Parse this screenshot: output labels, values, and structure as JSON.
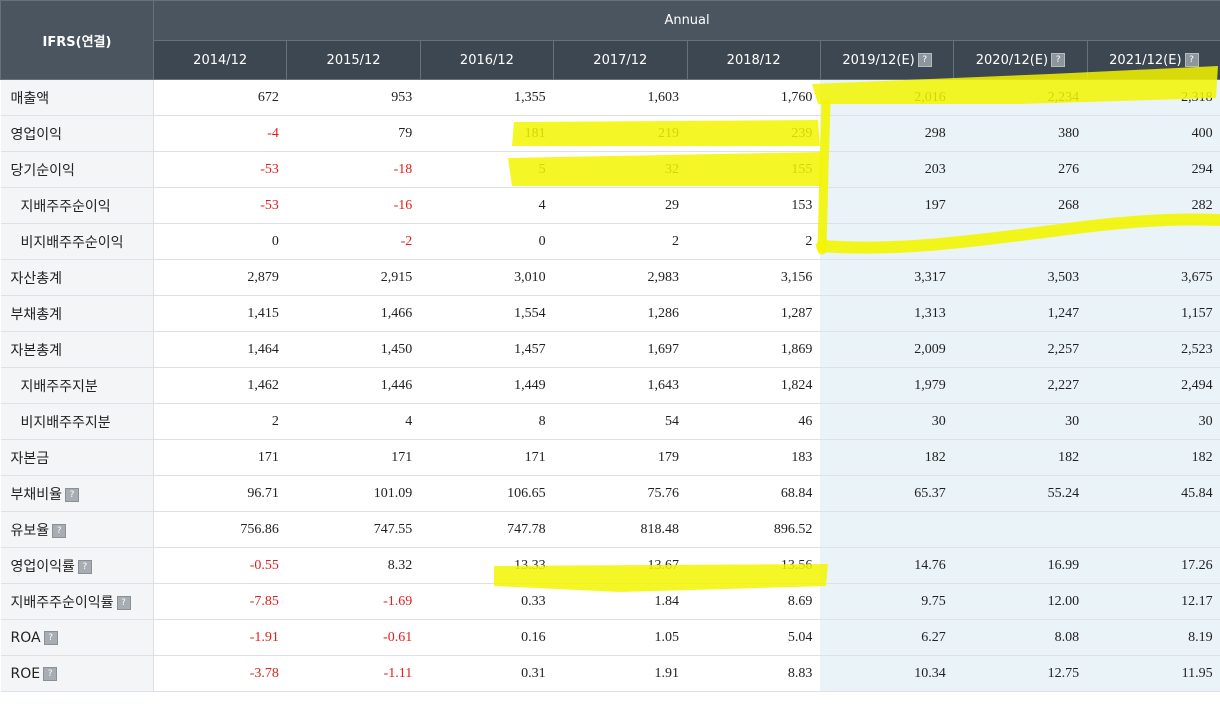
{
  "header": {
    "corner_label": "IFRS(연결)",
    "group_label": "Annual",
    "columns": [
      {
        "label": "2014/12",
        "estimate": false
      },
      {
        "label": "2015/12",
        "estimate": false
      },
      {
        "label": "2016/12",
        "estimate": false
      },
      {
        "label": "2017/12",
        "estimate": false
      },
      {
        "label": "2018/12",
        "estimate": false
      },
      {
        "label": "2019/12(E)",
        "estimate": true
      },
      {
        "label": "2020/12(E)",
        "estimate": true
      },
      {
        "label": "2021/12(E)",
        "estimate": true
      }
    ]
  },
  "rows": [
    {
      "label": "매출액",
      "sub": false,
      "help": false,
      "values": [
        "672",
        "953",
        "1,355",
        "1,603",
        "1,760",
        "2,016",
        "2,234",
        "2,318"
      ]
    },
    {
      "label": "영업이익",
      "sub": false,
      "help": false,
      "values": [
        "-4",
        "79",
        "181",
        "219",
        "239",
        "298",
        "380",
        "400"
      ]
    },
    {
      "label": "당기순이익",
      "sub": false,
      "help": false,
      "values": [
        "-53",
        "-18",
        "5",
        "32",
        "155",
        "203",
        "276",
        "294"
      ]
    },
    {
      "label": "지배주주순이익",
      "sub": true,
      "help": false,
      "values": [
        "-53",
        "-16",
        "4",
        "29",
        "153",
        "197",
        "268",
        "282"
      ]
    },
    {
      "label": "비지배주주순이익",
      "sub": true,
      "help": false,
      "values": [
        "0",
        "-2",
        "0",
        "2",
        "2",
        "",
        "",
        ""
      ]
    },
    {
      "label": "자산총계",
      "sub": false,
      "help": false,
      "values": [
        "2,879",
        "2,915",
        "3,010",
        "2,983",
        "3,156",
        "3,317",
        "3,503",
        "3,675"
      ]
    },
    {
      "label": "부채총계",
      "sub": false,
      "help": false,
      "values": [
        "1,415",
        "1,466",
        "1,554",
        "1,286",
        "1,287",
        "1,313",
        "1,247",
        "1,157"
      ]
    },
    {
      "label": "자본총계",
      "sub": false,
      "help": false,
      "values": [
        "1,464",
        "1,450",
        "1,457",
        "1,697",
        "1,869",
        "2,009",
        "2,257",
        "2,523"
      ]
    },
    {
      "label": "지배주주지분",
      "sub": true,
      "help": false,
      "values": [
        "1,462",
        "1,446",
        "1,449",
        "1,643",
        "1,824",
        "1,979",
        "2,227",
        "2,494"
      ]
    },
    {
      "label": "비지배주주지분",
      "sub": true,
      "help": false,
      "values": [
        "2",
        "4",
        "8",
        "54",
        "46",
        "30",
        "30",
        "30"
      ]
    },
    {
      "label": "자본금",
      "sub": false,
      "help": false,
      "values": [
        "171",
        "171",
        "171",
        "179",
        "183",
        "182",
        "182",
        "182"
      ]
    },
    {
      "label": "부채비율",
      "sub": false,
      "help": true,
      "values": [
        "96.71",
        "101.09",
        "106.65",
        "75.76",
        "68.84",
        "65.37",
        "55.24",
        "45.84"
      ]
    },
    {
      "label": "유보율",
      "sub": false,
      "help": true,
      "values": [
        "756.86",
        "747.55",
        "747.78",
        "818.48",
        "896.52",
        "",
        "",
        ""
      ]
    },
    {
      "label": "영업이익률",
      "sub": false,
      "help": true,
      "values": [
        "-0.55",
        "8.32",
        "13.33",
        "13.67",
        "13.56",
        "14.76",
        "16.99",
        "17.26"
      ]
    },
    {
      "label": "지배주주순이익률",
      "sub": false,
      "help": true,
      "values": [
        "-7.85",
        "-1.69",
        "0.33",
        "1.84",
        "8.69",
        "9.75",
        "12.00",
        "12.17"
      ]
    },
    {
      "label": "ROA",
      "sub": false,
      "help": true,
      "values": [
        "-1.91",
        "-0.61",
        "0.16",
        "1.05",
        "5.04",
        "6.27",
        "8.08",
        "8.19"
      ]
    },
    {
      "label": "ROE",
      "sub": false,
      "help": true,
      "values": [
        "-3.78",
        "-1.11",
        "0.31",
        "1.91",
        "8.83",
        "10.34",
        "12.75",
        "11.95"
      ]
    }
  ],
  "help_glyph": "?",
  "colors": {
    "header_bg": "#4a5560",
    "negative": "#e0201c",
    "estimate_bg": "#eaf3f8",
    "highlighter": "#f3f500"
  }
}
